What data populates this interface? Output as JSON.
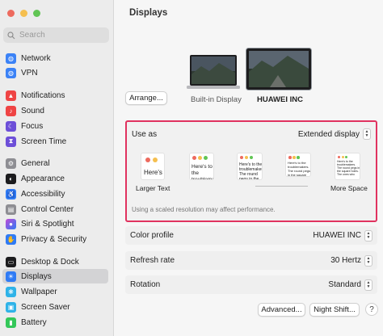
{
  "window": {
    "traffic_colors": [
      "#ed6a5e",
      "#f5bf4f",
      "#61c554"
    ]
  },
  "sidebar": {
    "search_placeholder": "Search",
    "items": [
      {
        "label": "Network",
        "icon": "network-icon",
        "color": "#3b82f6"
      },
      {
        "label": "VPN",
        "icon": "vpn-icon",
        "color": "#3b82f6"
      },
      {
        "label": "Notifications",
        "icon": "bell-icon",
        "color": "#ef4444"
      },
      {
        "label": "Sound",
        "icon": "speaker-icon",
        "color": "#ef4444"
      },
      {
        "label": "Focus",
        "icon": "moon-icon",
        "color": "#6d4fd8"
      },
      {
        "label": "Screen Time",
        "icon": "hourglass-icon",
        "color": "#6d4fd8"
      },
      {
        "label": "General",
        "icon": "gear-icon",
        "color": "#8e8e93"
      },
      {
        "label": "Appearance",
        "icon": "appearance-icon",
        "color": "#1c1c1e"
      },
      {
        "label": "Accessibility",
        "icon": "accessibility-icon",
        "color": "#2f7bf5"
      },
      {
        "label": "Control Center",
        "icon": "control-center-icon",
        "color": "#8e8e93"
      },
      {
        "label": "Siri & Spotlight",
        "icon": "siri-icon",
        "color": "#c04ad6"
      },
      {
        "label": "Privacy & Security",
        "icon": "hand-icon",
        "color": "#2f7bf5"
      },
      {
        "label": "Desktop & Dock",
        "icon": "dock-icon",
        "color": "#1c1c1e"
      },
      {
        "label": "Displays",
        "icon": "sun-icon",
        "color": "#2f7bf5",
        "active": true
      },
      {
        "label": "Wallpaper",
        "icon": "wallpaper-icon",
        "color": "#2fb3e8"
      },
      {
        "label": "Screen Saver",
        "icon": "screensaver-icon",
        "color": "#2fb3e8"
      },
      {
        "label": "Battery",
        "icon": "battery-icon",
        "color": "#34c759"
      }
    ]
  },
  "main": {
    "title": "Displays",
    "arrange_button": "Arrange...",
    "displays": [
      {
        "label": "Built-in Display",
        "selected": false
      },
      {
        "label": "HUAWEI INC",
        "selected": true
      }
    ],
    "use_as": {
      "label": "Use as",
      "value": "Extended display"
    },
    "resolutions": {
      "sample_text": "Here's",
      "sample_text_2": "Here's to the troublemakers",
      "sample_text_3": "Here's to the troublemakers. The round pegs in the square holes. The ones who",
      "larger_label": "Larger Text",
      "more_space_label": "More Space",
      "note": "Using a scaled resolution may affect performance."
    },
    "settings": [
      {
        "label": "Color profile",
        "value": "HUAWEI INC"
      },
      {
        "label": "Refresh rate",
        "value": "30 Hertz"
      },
      {
        "label": "Rotation",
        "value": "Standard"
      }
    ],
    "advanced_button": "Advanced...",
    "night_shift_button": "Night Shift...",
    "help_button": "?"
  },
  "colors": {
    "highlight_border": "#e0325f",
    "selection": "#d3d3d5"
  }
}
